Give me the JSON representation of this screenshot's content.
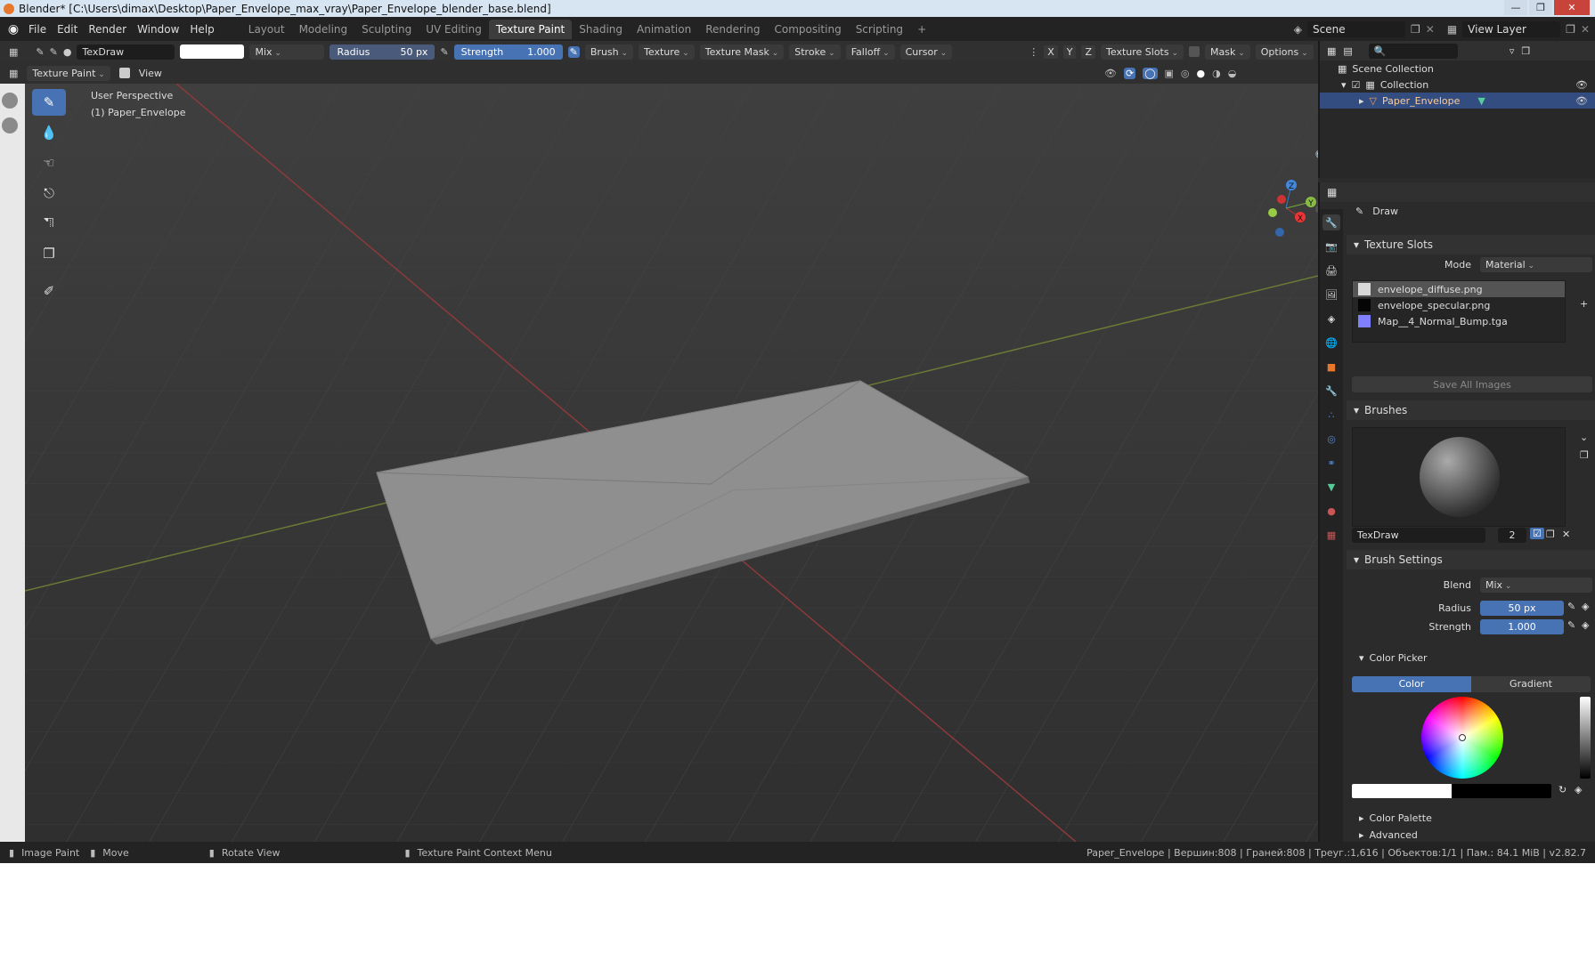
{
  "window": {
    "title": "Blender* [C:\\Users\\dimax\\Desktop\\Paper_Envelope_max_vray\\Paper_Envelope_blender_base.blend]"
  },
  "menu": [
    "File",
    "Edit",
    "Render",
    "Window",
    "Help"
  ],
  "workspaces": [
    "Layout",
    "Modeling",
    "Sculpting",
    "UV Editing",
    "Texture Paint",
    "Shading",
    "Animation",
    "Rendering",
    "Compositing",
    "Scripting"
  ],
  "active_workspace": "Texture Paint",
  "scene": {
    "name": "Scene",
    "view_layer": "View Layer"
  },
  "tool_header": {
    "brush_name": "TexDraw",
    "blend": "Mix",
    "radius_label": "Radius",
    "radius_value": "50 px",
    "strength_label": "Strength",
    "strength_value": "1.000",
    "menus": [
      "Brush",
      "Texture",
      "Texture Mask",
      "Stroke",
      "Falloff",
      "Cursor"
    ],
    "axes": [
      "X",
      "Y",
      "Z"
    ],
    "texture_slots": "Texture Slots",
    "mask": "Mask",
    "options": "Options"
  },
  "viewport_header": {
    "mode": "Texture Paint",
    "view": "View"
  },
  "viewport": {
    "perspective": "User Perspective",
    "object": "(1) Paper_Envelope"
  },
  "gizmo": {
    "z": "Z",
    "y": "Y",
    "x": "X"
  },
  "outliner": {
    "scene_collection": "Scene Collection",
    "collection": "Collection",
    "object": "Paper_Envelope"
  },
  "properties": {
    "tool_name": "Draw",
    "texture_slots": {
      "title": "Texture Slots",
      "mode_label": "Mode",
      "mode_value": "Material",
      "slots": [
        {
          "name": "envelope_diffuse.png",
          "color": "#d8d8d8"
        },
        {
          "name": "envelope_specular.png",
          "color": "#050505"
        },
        {
          "name": "Map__4_Normal_Bump.tga",
          "color": "#8080ff"
        }
      ],
      "save_all": "Save All Images"
    },
    "brushes": {
      "title": "Brushes",
      "brush_name": "TexDraw",
      "users": "2"
    },
    "brush_settings": {
      "title": "Brush Settings",
      "blend_label": "Blend",
      "blend_value": "Mix",
      "radius_label": "Radius",
      "radius_value": "50 px",
      "strength_label": "Strength",
      "strength_value": "1.000"
    },
    "color_picker": {
      "title": "Color Picker",
      "tab_color": "Color",
      "tab_gradient": "Gradient"
    },
    "color_palette": "Color Palette",
    "advanced": "Advanced"
  },
  "statusbar": {
    "image_paint": "Image Paint",
    "move": "Move",
    "rotate": "Rotate View",
    "context": "Texture Paint Context Menu",
    "stats": "Paper_Envelope | Вершин:808 | Граней:808 | Треуг.:1,616 | Объектов:1/1 | Пам.: 84.1 MiB | v2.82.7"
  },
  "colors": {
    "accent": "#4772b3",
    "selected_row": "#334d80",
    "object_orange": "#e8772e"
  }
}
